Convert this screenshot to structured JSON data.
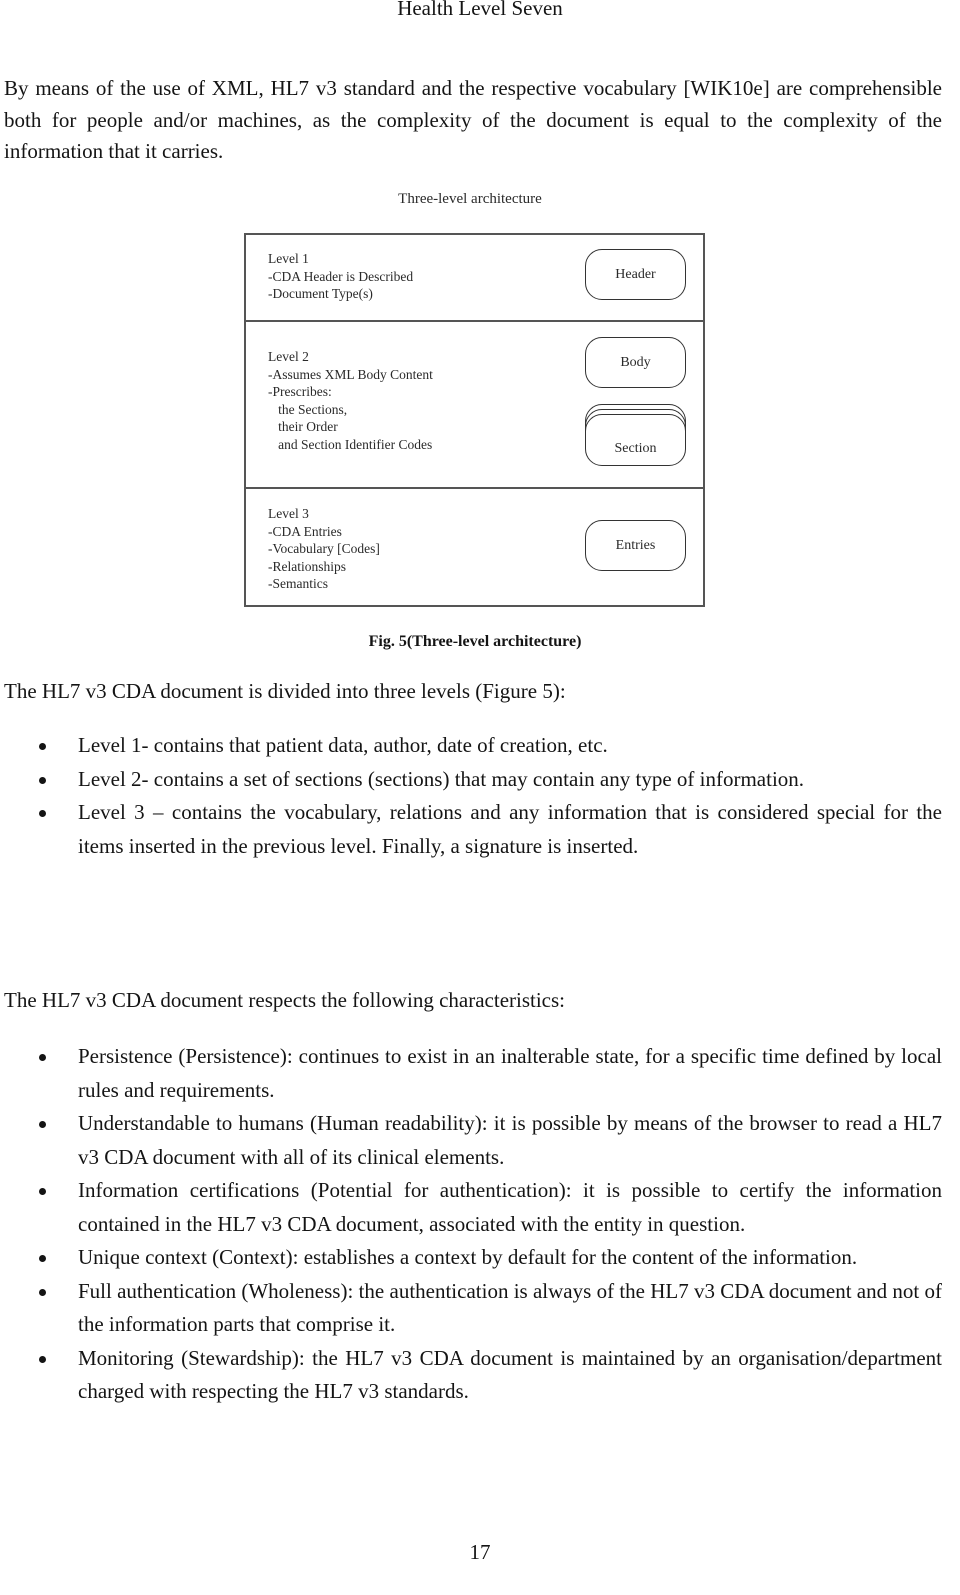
{
  "running_header": "Health Level Seven",
  "intro_paragraph": "By means of the use of XML, HL7 v3 standard and the respective vocabulary [WIK10e] are comprehensible both for people and/or machines, as the complexity of the document is equal to the complexity of the information that it carries.",
  "figure": {
    "title": "Three-level architecture",
    "levels": [
      {
        "text": "Level 1\n-CDA Header is Described\n-Document Type(s)",
        "boxes": [
          "Header"
        ]
      },
      {
        "text": "Level 2\n-Assumes XML Body Content\n-Prescribes:\n   the Sections,\n   their Order\n   and Section Identifier Codes",
        "boxes": [
          "Body",
          "Section"
        ]
      },
      {
        "text": "Level 3\n-CDA Entries\n-Vocabulary [Codes]\n-Relationships\n-Semantics",
        "boxes": [
          "Entries"
        ]
      }
    ],
    "caption": "Fig. 5(Three-level architecture)"
  },
  "levels_paragraph": "The HL7 v3 CDA document is divided into three levels (Figure 5):",
  "levels_list": [
    "Level 1- contains that patient data, author, date of creation, etc.",
    "Level 2- contains a set of sections (sections) that may contain any type of information.",
    "Level 3 – contains the vocabulary, relations and any information that is considered special for the items inserted in the previous level. Finally, a signature is inserted."
  ],
  "characteristics_paragraph": "The HL7 v3 CDA document respects the following characteristics:",
  "characteristics_list": [
    "Persistence (Persistence): continues to exist in an inalterable state, for a specific time defined by local rules and requirements.",
    "Understandable to humans (Human readability): it is possible by means of the browser to read a HL7 v3 CDA document with all of its clinical elements.",
    "Information certifications (Potential for authentication): it is possible to certify the information contained in the HL7 v3 CDA document, associated with the entity in question.",
    "Unique context (Context): establishes a context by default for the content of the information.",
    "Full authentication (Wholeness): the authentication is always of the HL7 v3 CDA document and not of the information parts that comprise it.",
    "Monitoring (Stewardship): the HL7 v3 CDA document is maintained by an organisation/department charged with respecting the HL7 v3 standards."
  ],
  "page_number": "17"
}
